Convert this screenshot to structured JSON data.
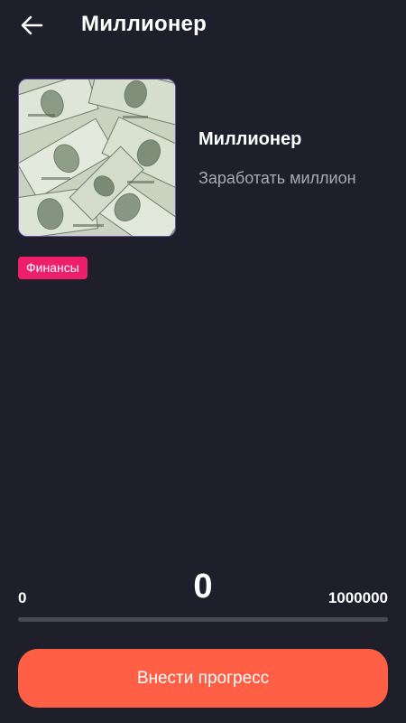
{
  "header": {
    "back_icon": "arrow-left-icon",
    "title": "Миллионер"
  },
  "goal": {
    "image": "money-banknotes-image",
    "name": "Миллионер",
    "description": "Заработать миллион",
    "category": "Финансы"
  },
  "progress": {
    "min_label": "0",
    "current_label": "0",
    "max_label": "1000000",
    "fraction": 0
  },
  "actions": {
    "submit_label": "Внести прогресс"
  },
  "colors": {
    "background": "#1f1f2b",
    "accent": "#ff5f45",
    "tag": "#ee1f6a",
    "muted_text": "#a9a9b4"
  }
}
